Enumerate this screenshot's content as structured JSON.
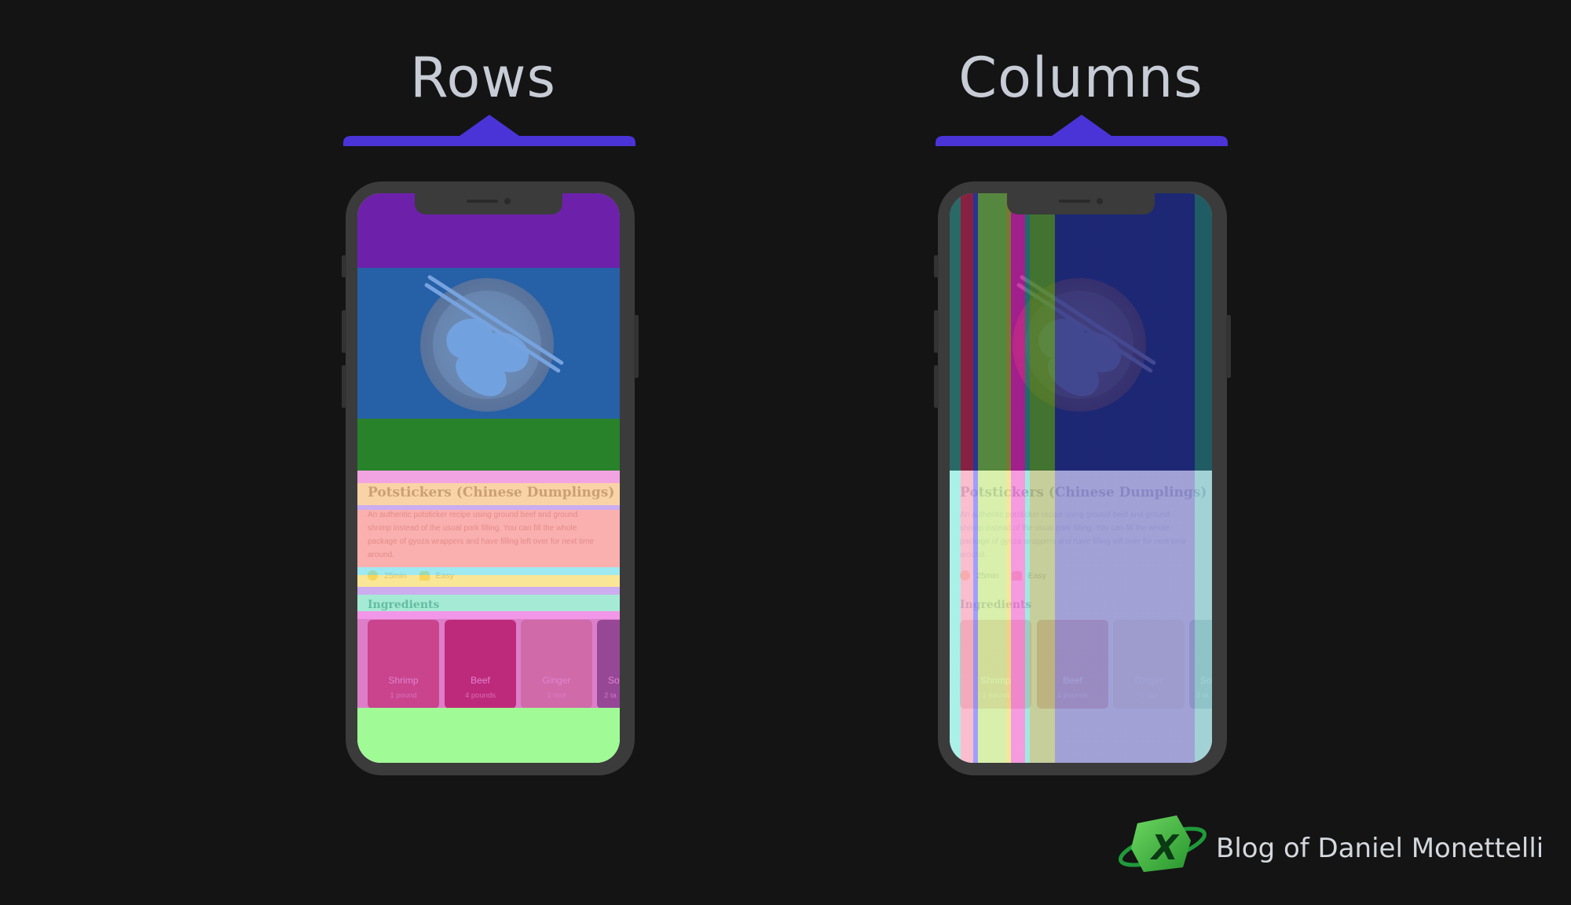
{
  "panels": {
    "rows_title": "Rows",
    "columns_title": "Columns"
  },
  "accent_color": "#4a34d8",
  "recipe": {
    "title": "Potstickers (Chinese Dumplings)",
    "description": "An authentic potsticker recipe using ground beef and ground shrimp instead of the usual pork filling. You can fill the whole package of gyoza wrappers and have filling left over for next time around.",
    "time": "25min",
    "difficulty": "Easy",
    "ingredients_label": "Ingredients",
    "ingredients": [
      {
        "name": "Shrimp",
        "qty": "1 pound",
        "color": "#c9716b"
      },
      {
        "name": "Beef",
        "qty": "4 pounds",
        "color": "#b23a44"
      },
      {
        "name": "Ginger",
        "qty": "1 root",
        "color": "#d9c7a8"
      },
      {
        "name": "So",
        "qty": "2 ta",
        "color": "#5a7d80"
      }
    ]
  },
  "brand": {
    "text": "Blog of Daniel Monettelli",
    "logo_icon": "x-planet-logo"
  }
}
